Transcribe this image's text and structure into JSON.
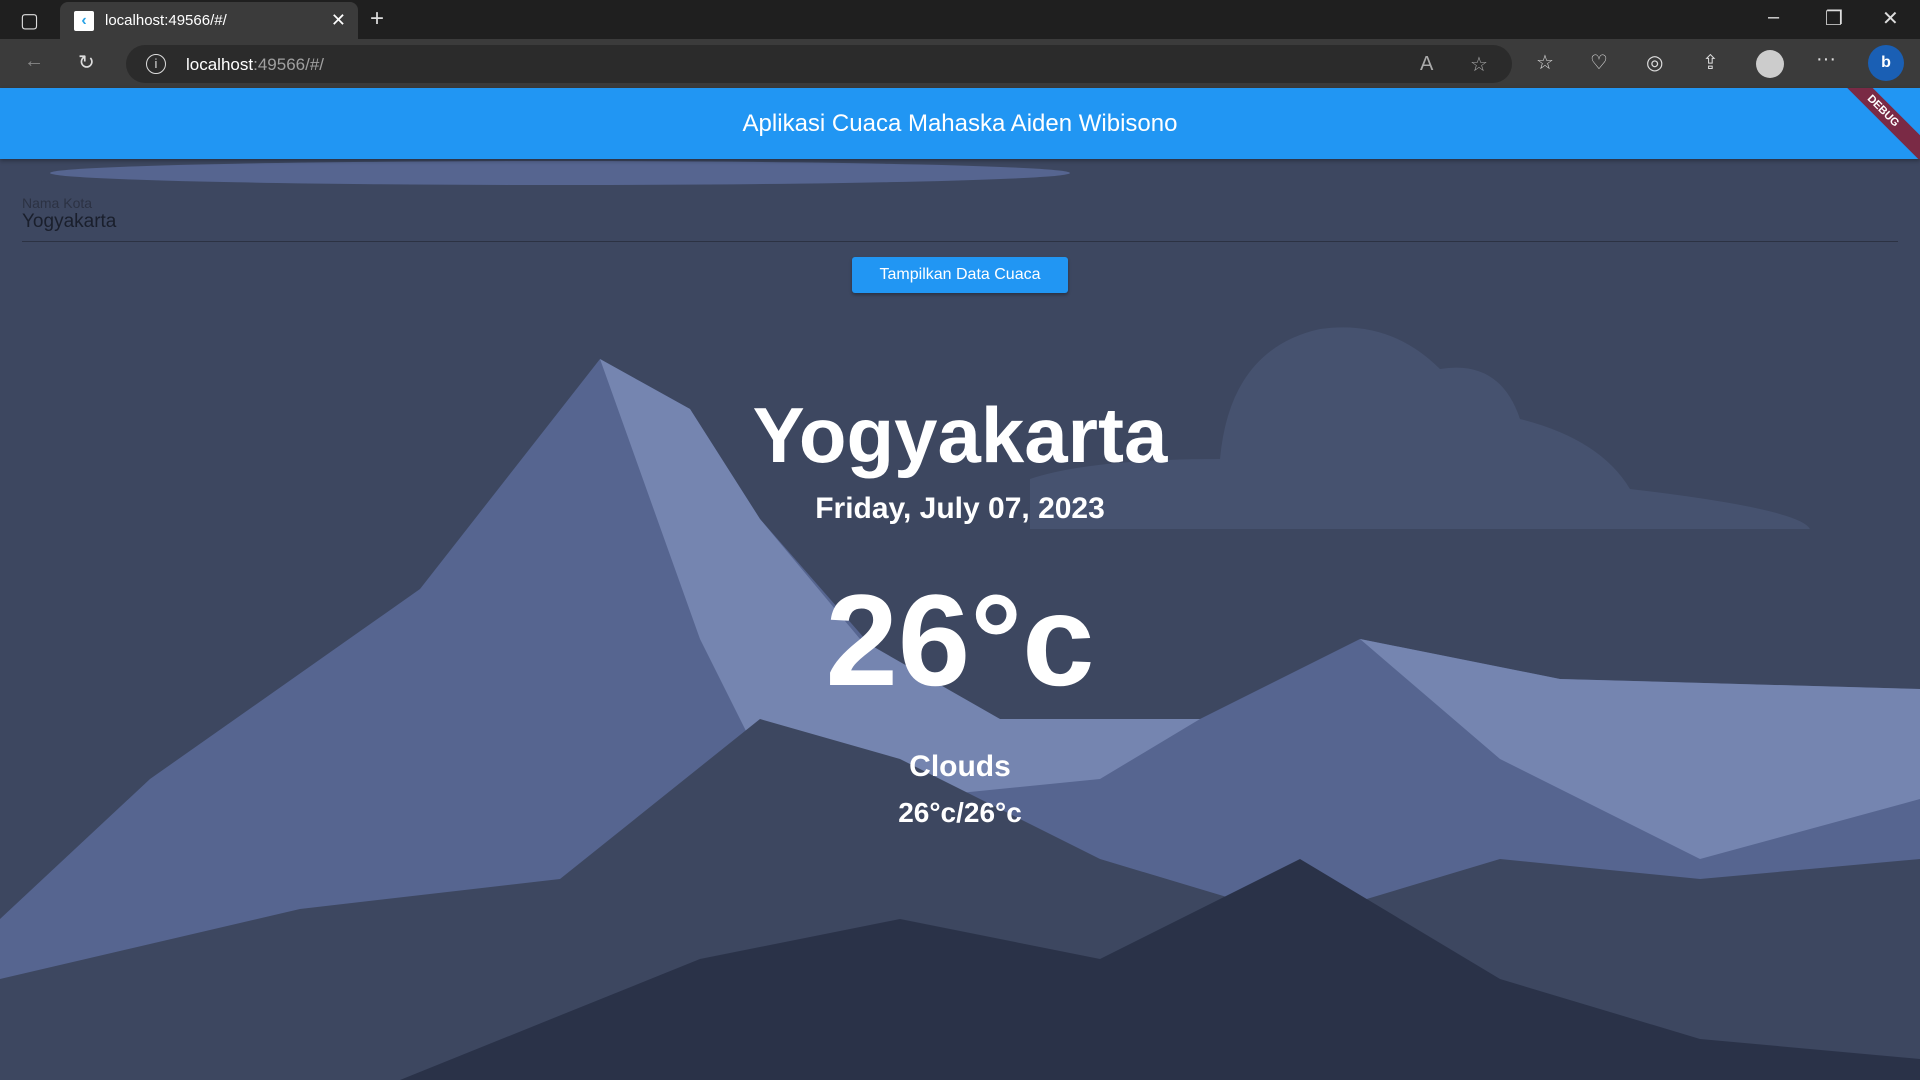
{
  "browser": {
    "tab_title": "localhost:49566/#/",
    "url_host": "localhost",
    "url_rest": ":49566/#/"
  },
  "app": {
    "title": "Aplikasi Cuaca Mahaska Aiden Wibisono",
    "debug_banner": "DEBUG"
  },
  "form": {
    "label": "Nama Kota",
    "value": "Yogyakarta",
    "button": "Tampilkan Data Cuaca"
  },
  "weather": {
    "city": "Yogyakarta",
    "date": "Friday, July 07, 2023",
    "temp": "26°c",
    "condition": "Clouds",
    "range": "26°c/26°c"
  },
  "colors": {
    "accent": "#2196f3",
    "background": "#3d4760"
  }
}
